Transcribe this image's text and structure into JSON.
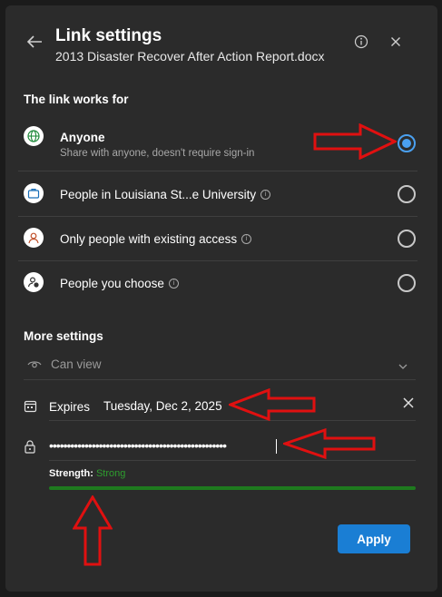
{
  "header": {
    "title": "Link settings",
    "subtitle": "2013 Disaster Recover After Action Report.docx"
  },
  "link_works_for": {
    "heading": "The link works for",
    "options": [
      {
        "label": "Anyone",
        "sublabel": "Share with anyone, doesn't require sign-in",
        "icon": "globe-icon",
        "selected": true
      },
      {
        "label": "People in Louisiana St...e University",
        "icon": "briefcase-icon",
        "selected": false,
        "info": true
      },
      {
        "label": "Only people with existing access",
        "icon": "person-icon",
        "selected": false,
        "info": true
      },
      {
        "label": "People you choose",
        "icon": "people-icon",
        "selected": false,
        "info": true
      }
    ]
  },
  "more_settings": {
    "heading": "More settings",
    "permission": "Can view",
    "expires_label": "Expires",
    "expires_date": "Tuesday, Dec 2, 2025",
    "password_mask": "••••••••••••••••••••••••••••••••••••••••••••••••••",
    "strength_label": "Strength:",
    "strength_value": "Strong",
    "strength_color": "#2e9e2e"
  },
  "actions": {
    "apply_label": "Apply"
  },
  "colors": {
    "accent": "#1a7ed4",
    "radio_selected": "#4aa0f0",
    "annotation_arrow": "#e01010"
  }
}
